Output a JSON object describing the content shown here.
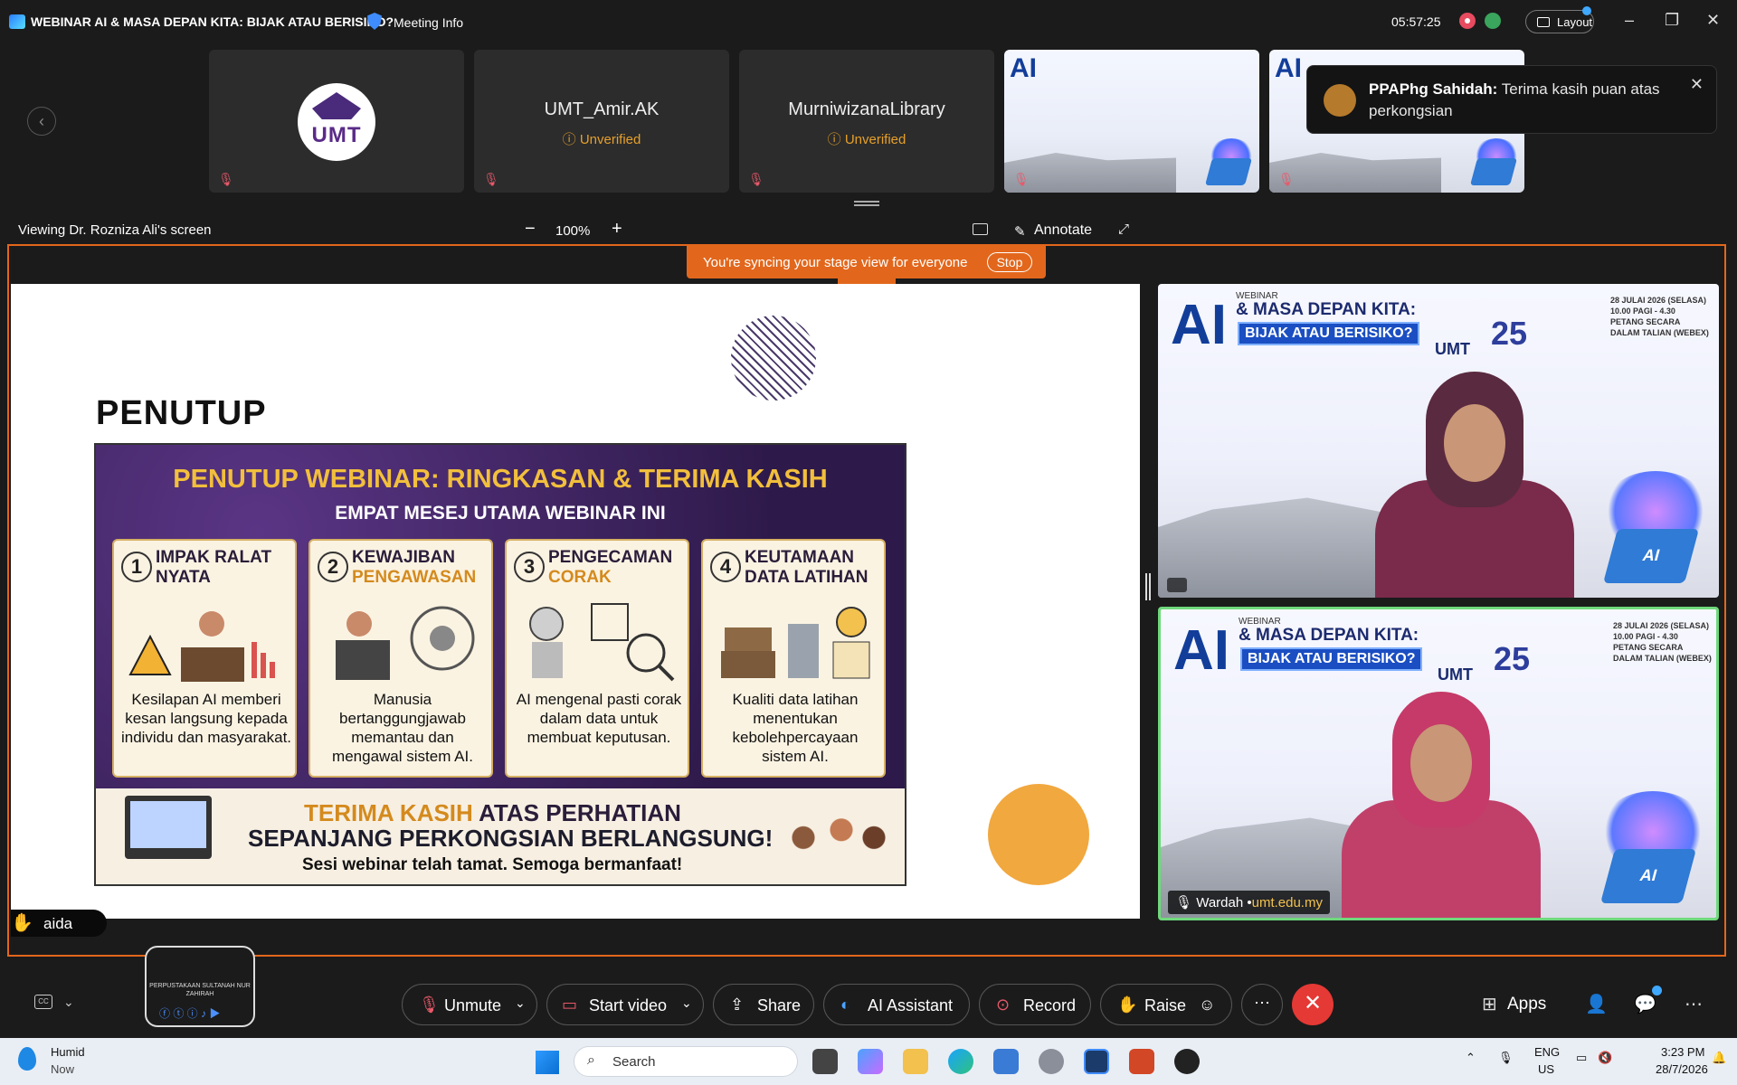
{
  "titlebar": {
    "title": "WEBINAR AI & MASA DEPAN KITA: BIJAK ATAU BERISIKO?",
    "meeting_info": "Meeting Info",
    "clock": "05:57:25",
    "layout": "Layout",
    "minimize": "–",
    "restore": "❐",
    "close": "✕"
  },
  "participants": [
    {
      "name": "",
      "type": "logo",
      "logo_text": "UMT"
    },
    {
      "name": "UMT_Amir.AK",
      "status": "Unverified"
    },
    {
      "name": "MurniwizanaLibrary",
      "status": "Unverified"
    },
    {
      "name": "",
      "type": "slide"
    },
    {
      "name": "",
      "type": "slide"
    }
  ],
  "toast": {
    "sender": "PPAPhg Sahidah:",
    "message": "Terima kasih puan atas perkongsian"
  },
  "viewbar": {
    "viewing": "Viewing Dr. Rozniza Ali's screen",
    "zoom": "100%",
    "annotate": "Annotate"
  },
  "sync": {
    "message": "You're syncing your stage view for everyone",
    "stop": "Stop"
  },
  "slide": {
    "title": "PENUTUP",
    "info_title": "PENUTUP WEBINAR: RINGKASAN & TERIMA KASIH",
    "info_subtitle": "EMPAT MESEJ UTAMA WEBINAR INI",
    "cards": [
      {
        "num": "1",
        "title_line1": "IMPAK RALAT",
        "title_line2": "NYATA",
        "desc": "Kesilapan AI memberi kesan langsung kepada individu dan masyarakat."
      },
      {
        "num": "2",
        "title_line1": "KEWAJIBAN",
        "title_line2": "PENGAWASAN",
        "desc": "Manusia bertanggungjawab memantau dan mengawal sistem AI."
      },
      {
        "num": "3",
        "title_line1": "PENGECAMAN",
        "title_line2": "CORAK",
        "desc": "AI mengenal pasti corak dalam data untuk membuat keputusan."
      },
      {
        "num": "4",
        "title_line1": "KEUTAMAAN",
        "title_line2": "DATA LATIHAN",
        "desc": "Kualiti data latihan menentukan kebolehpercayaan sistem AI."
      }
    ],
    "thanks_orange": "TERIMA KASIH",
    "thanks_rest": " ATAS PERHATIAN",
    "thanks_line2": "SEPANJANG PERKONGSIAN BERLANGSUNG!",
    "thanks_line3": "Sesi webinar telah tamat. Semoga bermanfaat!"
  },
  "raise_hand": {
    "name": "aida"
  },
  "videos": [
    {
      "label": "",
      "banner_ai": "AI",
      "banner_webinar": "WEBINAR",
      "banner_title": "& MASA DEPAN KITA:",
      "banner_sub": "BIJAK ATAU BERISIKO?",
      "umt": "UMT",
      "num": "25",
      "date": "28 JULAI 2026 (SELASA) 10.00 PAGI - 4.30 PETANG SECARA DALAM TALIAN (WEBEX)"
    },
    {
      "label_name": "Wardah",
      "label_domain": "umt.edu.my",
      "banner_ai": "AI",
      "banner_webinar": "WEBINAR",
      "banner_title": "& MASA DEPAN KITA:",
      "banner_sub": "BIJAK ATAU BERISIKO?",
      "umt": "UMT",
      "num": "25",
      "date": "28 JULAI 2026 (SELASA) 10.00 PAGI - 4.30 PETANG SECARA DALAM TALIAN (WEBEX)"
    }
  ],
  "toolbar": {
    "unmute": "Unmute",
    "start_video": "Start video",
    "share": "Share",
    "ai_assistant": "AI Assistant",
    "record": "Record",
    "raise": "Raise",
    "apps": "Apps",
    "library_logo_text": "PERPUSTAKAAN SULTANAH NUR ZAHIRAH"
  },
  "taskbar": {
    "weather": "Humid",
    "weather_time": "Now",
    "search": "Search",
    "lang1": "ENG",
    "lang2": "US",
    "time": "3:23 PM",
    "date": "28/7/2026"
  },
  "colors": {
    "accent_orange": "#e2671c",
    "active_speaker": "#6fd97c",
    "end_call": "#e53935"
  }
}
